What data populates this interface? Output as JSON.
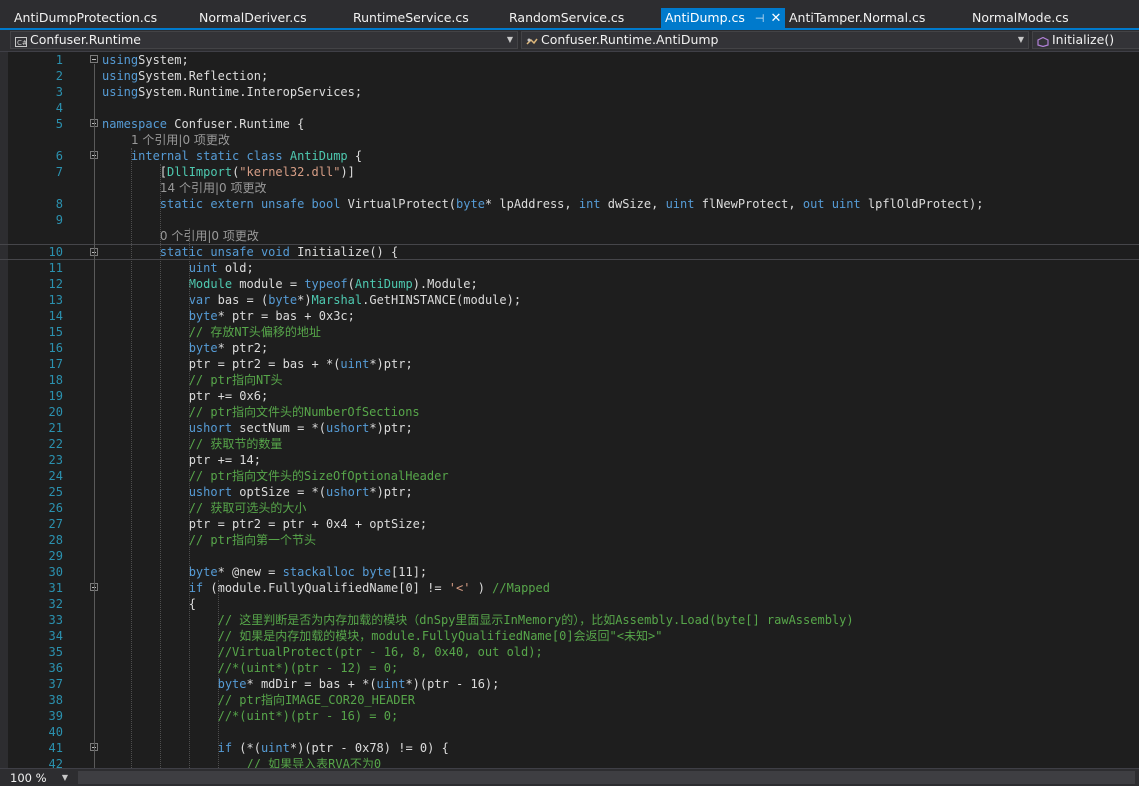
{
  "tabs": [
    {
      "label": "AntiDumpProtection.cs",
      "active": false
    },
    {
      "label": "NormalDeriver.cs",
      "active": false
    },
    {
      "label": "RuntimeService.cs",
      "active": false
    },
    {
      "label": "RandomService.cs",
      "active": false
    },
    {
      "label": "AntiDump.cs",
      "active": true
    },
    {
      "label": "AntiTamper.Normal.cs",
      "active": false
    },
    {
      "label": "NormalMode.cs",
      "active": false
    }
  ],
  "nav": {
    "project": "Confuser.Runtime",
    "type": "Confuser.Runtime.AntiDump",
    "member": "Initialize()"
  },
  "codelens": {
    "ns_refs": "1 个引用|0 项更改",
    "import_refs": "14 个引用|0 项更改",
    "init_refs": "0 个引用|0 项更改"
  },
  "zoom": "100 %",
  "colors": {
    "accent": "#007acc",
    "keyword": "#569cd6",
    "type": "#4ec9b0",
    "string": "#d69d85",
    "comment": "#57a64a",
    "line_number": "#2b91af"
  },
  "code": [
    {
      "n": "1",
      "fold": true,
      "tokens": [
        [
          "kw",
          "using"
        ],
        [
          "",
          "System;"
        ]
      ]
    },
    {
      "n": "2",
      "fold": false,
      "tokens": [
        [
          "kw",
          "using"
        ],
        [
          "",
          "System.Reflection;"
        ]
      ]
    },
    {
      "n": "3",
      "fold": false,
      "tokens": [
        [
          "kw",
          "using"
        ],
        [
          "",
          "System.Runtime.InteropServices;"
        ]
      ]
    },
    {
      "n": "4",
      "fold": false,
      "tokens": []
    },
    {
      "n": "5",
      "fold": true,
      "tokens": [
        [
          "kw",
          "namespace"
        ],
        [
          "",
          " Confuser.Runtime {"
        ]
      ]
    },
    {
      "lens": "ns_refs",
      "indent": 4
    },
    {
      "n": "6",
      "fold": true,
      "tokens": [
        [
          "",
          "    "
        ],
        [
          "kw",
          "internal static class"
        ],
        [
          "",
          " "
        ],
        [
          "ty",
          "AntiDump"
        ],
        [
          "",
          " {"
        ]
      ]
    },
    {
      "n": "7",
      "fold": false,
      "tokens": [
        [
          "",
          "        ["
        ],
        [
          "ty",
          "DllImport"
        ],
        [
          "",
          "("
        ],
        [
          "st",
          "\"kernel32.dll\""
        ],
        [
          "",
          ")]"
        ]
      ]
    },
    {
      "lens": "import_refs",
      "indent": 8
    },
    {
      "n": "8",
      "fold": false,
      "tokens": [
        [
          "",
          "        "
        ],
        [
          "kw",
          "static extern unsafe bool"
        ],
        [
          "",
          " VirtualProtect("
        ],
        [
          "kw",
          "byte"
        ],
        [
          "",
          "* lpAddress, "
        ],
        [
          "kw",
          "int"
        ],
        [
          "",
          " dwSize, "
        ],
        [
          "kw",
          "uint"
        ],
        [
          "",
          " flNewProtect, "
        ],
        [
          "kw",
          "out uint"
        ],
        [
          "",
          " lpflOldProtect);"
        ]
      ]
    },
    {
      "n": "9",
      "fold": false,
      "tokens": []
    },
    {
      "lens": "init_refs",
      "indent": 8
    },
    {
      "n": "10",
      "fold": true,
      "current": true,
      "tokens": [
        [
          "",
          "        "
        ],
        [
          "kw",
          "static unsafe void"
        ],
        [
          "",
          " Initialize() {"
        ]
      ]
    },
    {
      "n": "11",
      "fold": false,
      "tokens": [
        [
          "",
          "            "
        ],
        [
          "kw",
          "uint"
        ],
        [
          "",
          " old;"
        ]
      ]
    },
    {
      "n": "12",
      "fold": false,
      "tokens": [
        [
          "",
          "            "
        ],
        [
          "ty",
          "Module"
        ],
        [
          "",
          " module = "
        ],
        [
          "kw",
          "typeof"
        ],
        [
          "",
          "("
        ],
        [
          "ty",
          "AntiDump"
        ],
        [
          "",
          ").Module;"
        ]
      ]
    },
    {
      "n": "13",
      "fold": false,
      "tokens": [
        [
          "",
          "            "
        ],
        [
          "kw",
          "var"
        ],
        [
          "",
          " bas = ("
        ],
        [
          "kw",
          "byte"
        ],
        [
          "",
          "*)"
        ],
        [
          "ty",
          "Marshal"
        ],
        [
          "",
          ".GetHINSTANCE(module);"
        ]
      ]
    },
    {
      "n": "14",
      "fold": false,
      "tokens": [
        [
          "",
          "            "
        ],
        [
          "kw",
          "byte"
        ],
        [
          "",
          "* ptr = bas + 0x3c;"
        ]
      ]
    },
    {
      "n": "15",
      "fold": false,
      "tokens": [
        [
          "",
          "            "
        ],
        [
          "cm",
          "// 存放NT头偏移的地址"
        ]
      ]
    },
    {
      "n": "16",
      "fold": false,
      "tokens": [
        [
          "",
          "            "
        ],
        [
          "kw",
          "byte"
        ],
        [
          "",
          "* ptr2;"
        ]
      ]
    },
    {
      "n": "17",
      "fold": false,
      "tokens": [
        [
          "",
          "            ptr = ptr2 = bas + *("
        ],
        [
          "kw",
          "uint"
        ],
        [
          "",
          "*)ptr;"
        ]
      ]
    },
    {
      "n": "18",
      "fold": false,
      "tokens": [
        [
          "",
          "            "
        ],
        [
          "cm",
          "// ptr指向NT头"
        ]
      ]
    },
    {
      "n": "19",
      "fold": false,
      "tokens": [
        [
          "",
          "            ptr += 0x6;"
        ]
      ]
    },
    {
      "n": "20",
      "fold": false,
      "tokens": [
        [
          "",
          "            "
        ],
        [
          "cm",
          "// ptr指向文件头的NumberOfSections"
        ]
      ]
    },
    {
      "n": "21",
      "fold": false,
      "tokens": [
        [
          "",
          "            "
        ],
        [
          "kw",
          "ushort"
        ],
        [
          "",
          " sectNum = *("
        ],
        [
          "kw",
          "ushort"
        ],
        [
          "",
          "*)ptr;"
        ]
      ]
    },
    {
      "n": "22",
      "fold": false,
      "tokens": [
        [
          "",
          "            "
        ],
        [
          "cm",
          "// 获取节的数量"
        ]
      ]
    },
    {
      "n": "23",
      "fold": false,
      "tokens": [
        [
          "",
          "            ptr += 14;"
        ]
      ]
    },
    {
      "n": "24",
      "fold": false,
      "tokens": [
        [
          "",
          "            "
        ],
        [
          "cm",
          "// ptr指向文件头的SizeOfOptionalHeader"
        ]
      ]
    },
    {
      "n": "25",
      "fold": false,
      "tokens": [
        [
          "",
          "            "
        ],
        [
          "kw",
          "ushort"
        ],
        [
          "",
          " optSize = *("
        ],
        [
          "kw",
          "ushort"
        ],
        [
          "",
          "*)ptr;"
        ]
      ]
    },
    {
      "n": "26",
      "fold": false,
      "tokens": [
        [
          "",
          "            "
        ],
        [
          "cm",
          "// 获取可选头的大小"
        ]
      ]
    },
    {
      "n": "27",
      "fold": false,
      "tokens": [
        [
          "",
          "            ptr = ptr2 = ptr + 0x4 + optSize;"
        ]
      ]
    },
    {
      "n": "28",
      "fold": false,
      "tokens": [
        [
          "",
          "            "
        ],
        [
          "cm",
          "// ptr指向第一个节头"
        ]
      ]
    },
    {
      "n": "29",
      "fold": false,
      "tokens": []
    },
    {
      "n": "30",
      "fold": false,
      "tokens": [
        [
          "",
          "            "
        ],
        [
          "kw",
          "byte"
        ],
        [
          "",
          "* @new = "
        ],
        [
          "kw",
          "stackalloc byte"
        ],
        [
          "",
          "[11];"
        ]
      ]
    },
    {
      "n": "31",
      "fold": true,
      "tokens": [
        [
          "",
          "            "
        ],
        [
          "kw",
          "if"
        ],
        [
          "",
          " (module.FullyQualifiedName[0] != "
        ],
        [
          "st",
          "'<'"
        ],
        [
          "",
          " ) "
        ],
        [
          "cm",
          "//Mapped"
        ]
      ]
    },
    {
      "n": "32",
      "fold": false,
      "tokens": [
        [
          "",
          "            {"
        ]
      ]
    },
    {
      "n": "33",
      "fold": false,
      "tokens": [
        [
          "",
          "                "
        ],
        [
          "cm",
          "// 这里判断是否为内存加载的模块（dnSpy里面显示InMemory的），比如Assembly.Load(byte[] rawAssembly)"
        ]
      ]
    },
    {
      "n": "34",
      "fold": false,
      "tokens": [
        [
          "",
          "                "
        ],
        [
          "cm",
          "// 如果是内存加载的模块，module.FullyQualifiedName[0]会返回\"<未知>\""
        ]
      ]
    },
    {
      "n": "35",
      "fold": false,
      "tokens": [
        [
          "",
          "                "
        ],
        [
          "cm",
          "//VirtualProtect(ptr - 16, 8, 0x40, out old);"
        ]
      ]
    },
    {
      "n": "36",
      "fold": false,
      "tokens": [
        [
          "",
          "                "
        ],
        [
          "cm",
          "//*(uint*)(ptr - 12) = 0;"
        ]
      ]
    },
    {
      "n": "37",
      "fold": false,
      "tokens": [
        [
          "",
          "                "
        ],
        [
          "kw",
          "byte"
        ],
        [
          "",
          "* mdDir = bas + *("
        ],
        [
          "kw",
          "uint"
        ],
        [
          "",
          "*)(ptr - 16);"
        ]
      ]
    },
    {
      "n": "38",
      "fold": false,
      "tokens": [
        [
          "",
          "                "
        ],
        [
          "cm",
          "// ptr指向IMAGE_COR20_HEADER"
        ]
      ]
    },
    {
      "n": "39",
      "fold": false,
      "tokens": [
        [
          "",
          "                "
        ],
        [
          "cm",
          "//*(uint*)(ptr - 16) = 0;"
        ]
      ]
    },
    {
      "n": "40",
      "fold": false,
      "tokens": []
    },
    {
      "n": "41",
      "fold": true,
      "tokens": [
        [
          "",
          "                "
        ],
        [
          "kw",
          "if"
        ],
        [
          "",
          " (*("
        ],
        [
          "kw",
          "uint"
        ],
        [
          "",
          "*)(ptr - 0x78) != 0) {"
        ]
      ]
    },
    {
      "n": "42",
      "fold": false,
      "tokens": [
        [
          "",
          "                    "
        ],
        [
          "cm",
          "// 如果导入表RVA不为0"
        ]
      ]
    }
  ]
}
